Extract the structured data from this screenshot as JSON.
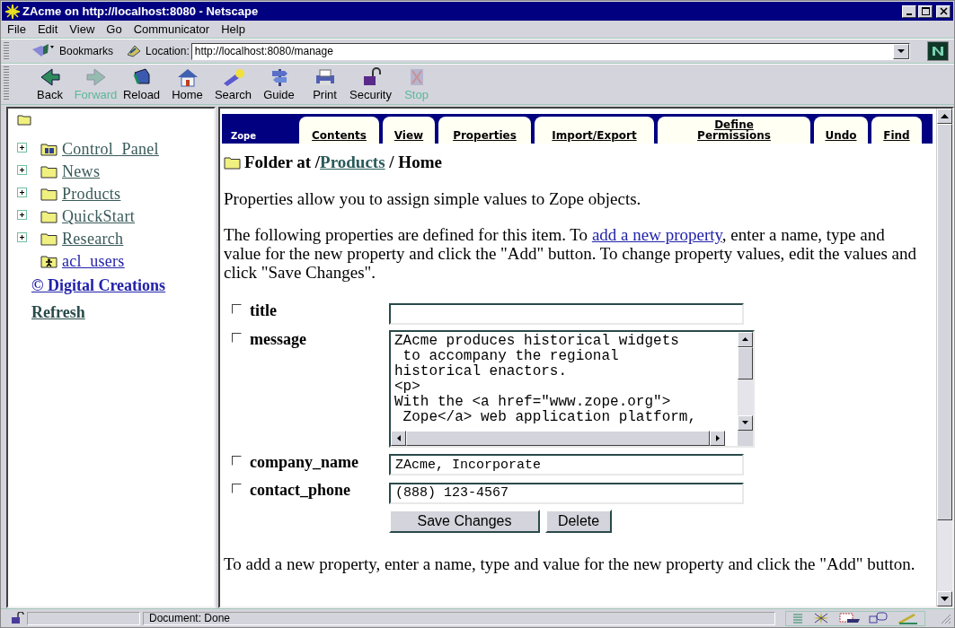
{
  "window": {
    "title": "ZAcme on http://localhost:8080 - Netscape"
  },
  "menu": [
    "File",
    "Edit",
    "View",
    "Go",
    "Communicator",
    "Help"
  ],
  "location_bar": {
    "bookmarks": "Bookmarks",
    "label": "Location:",
    "url": "http://localhost:8080/manage"
  },
  "toolbar": [
    {
      "label": "Back",
      "disabled": false
    },
    {
      "label": "Forward",
      "disabled": true
    },
    {
      "label": "Reload",
      "disabled": false
    },
    {
      "label": "Home",
      "disabled": false
    },
    {
      "label": "Search",
      "disabled": false
    },
    {
      "label": "Guide",
      "disabled": false
    },
    {
      "label": "Print",
      "disabled": false
    },
    {
      "label": "Security",
      "disabled": false
    },
    {
      "label": "Stop",
      "disabled": true
    }
  ],
  "sidebar": {
    "items": [
      {
        "label": "Control_Panel",
        "kind": "control-panel",
        "expandable": true
      },
      {
        "label": "News",
        "kind": "folder",
        "expandable": true
      },
      {
        "label": "Products",
        "kind": "folder",
        "expandable": true
      },
      {
        "label": "QuickStart",
        "kind": "folder",
        "expandable": true
      },
      {
        "label": "Research",
        "kind": "folder",
        "expandable": true
      },
      {
        "label": "acl_users",
        "kind": "user-folder",
        "expandable": false
      }
    ],
    "links": [
      "© Digital Creations",
      "Refresh"
    ]
  },
  "tabs_logo": "Zope",
  "tabs": [
    {
      "label": "Contents",
      "selected": false
    },
    {
      "label": "View",
      "selected": false
    },
    {
      "label": "Properties",
      "selected": false
    },
    {
      "label": "Import/Export",
      "selected": false
    },
    {
      "label": "Define Permissions",
      "selected": false
    },
    {
      "label": "Undo",
      "selected": false
    },
    {
      "label": "Find",
      "selected": false
    }
  ],
  "heading": {
    "prefix": "Folder at /",
    "link": "Products",
    "suffix": " / Home"
  },
  "intro": "Properties allow you to assign simple values to Zope objects.",
  "description": {
    "before": "The following properties are defined for this item. To ",
    "link": "add a new property",
    "after": ", enter a name, type and value for the new property and click the \"Add\" button. To change property values, edit the values and click \"Save Changes\"."
  },
  "properties": [
    {
      "name": "title",
      "kind": "line",
      "checked": false
    },
    {
      "name": "message",
      "kind": "text",
      "value": "ZAcme produces historical widgets\n to accompany the regional\nhistorical enactors.\n<p>\nWith the <a href=\"www.zope.org\">\n Zope</a> web application platform,",
      "checked": false
    },
    {
      "name": "company_name",
      "kind": "line",
      "value": "ZAcme, Incorporate",
      "checked": false
    },
    {
      "name": "contact_phone",
      "kind": "line",
      "value": "(888) 123-4567",
      "checked": false
    }
  ],
  "buttons": [
    "Save Changes",
    "Delete"
  ],
  "footer_text": "To add a new property, enter a name, type and value for the new property and click the \"Add\" button.",
  "status_bar": {
    "text": "Document: Done"
  }
}
